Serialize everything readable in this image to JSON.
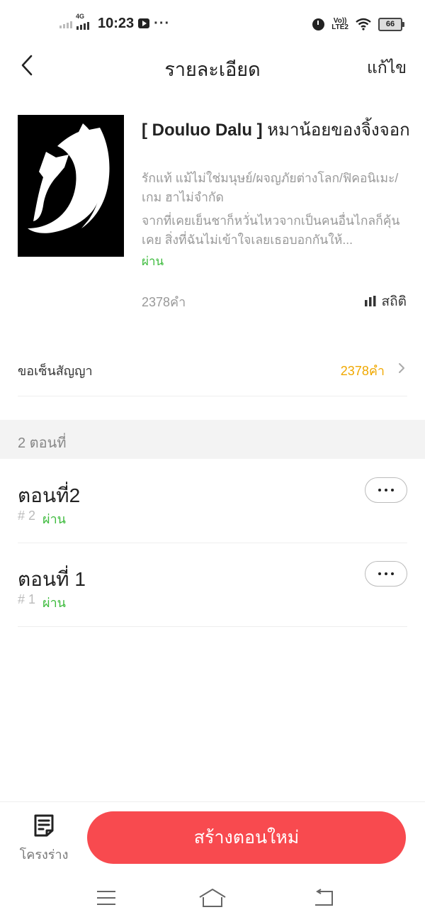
{
  "status_bar": {
    "network": "4G",
    "time": "10:23",
    "more": "···",
    "volte": "Vo)) LTE2",
    "battery": "66"
  },
  "header": {
    "title": "รายละเอียด",
    "edit_label": "แก้ไข"
  },
  "book": {
    "title_bold": "[ Douluo Dalu ]",
    "title_rest": " หมาน้อยของจิ้งจอก",
    "genres": "รักแท้ แม้ไม่ใช่มนุษย์/ผจญภัยต่างโลก/ฟิคอนิเมะ/เกม ฮาไม่จำกัด",
    "description": "จากที่เคยเย็นชาก็หวั่นไหวจากเป็นคนอื่นไกลก็คุ้นเคย สิ่งที่ฉันไม่เข้าใจเลยเธอบอกกันให้...",
    "status": "ผ่าน",
    "word_count": "2378คำ",
    "stats_label": "สถิติ"
  },
  "contract": {
    "label": "ขอเซ็นสัญญา",
    "value": "2378คำ"
  },
  "chapters_header": "2 ตอนที่",
  "chapters": [
    {
      "title": "ตอนที่2",
      "number": "# 2",
      "status": "ผ่าน"
    },
    {
      "title": "ตอนที่ 1",
      "number": "# 1",
      "status": "ผ่าน"
    }
  ],
  "bottom_bar": {
    "outline_label": "โครงร่าง",
    "create_label": "สร้างตอนใหม่"
  },
  "colors": {
    "accent_red": "#f84a4f",
    "status_green": "#3dbb3d",
    "highlight_orange": "#f0a800"
  },
  "icons": [
    "chevron-left-icon",
    "bar-chart-icon",
    "chevron-right-icon",
    "more-dots-icon",
    "document-icon",
    "menu-icon",
    "home-icon",
    "back-arrow-icon"
  ]
}
